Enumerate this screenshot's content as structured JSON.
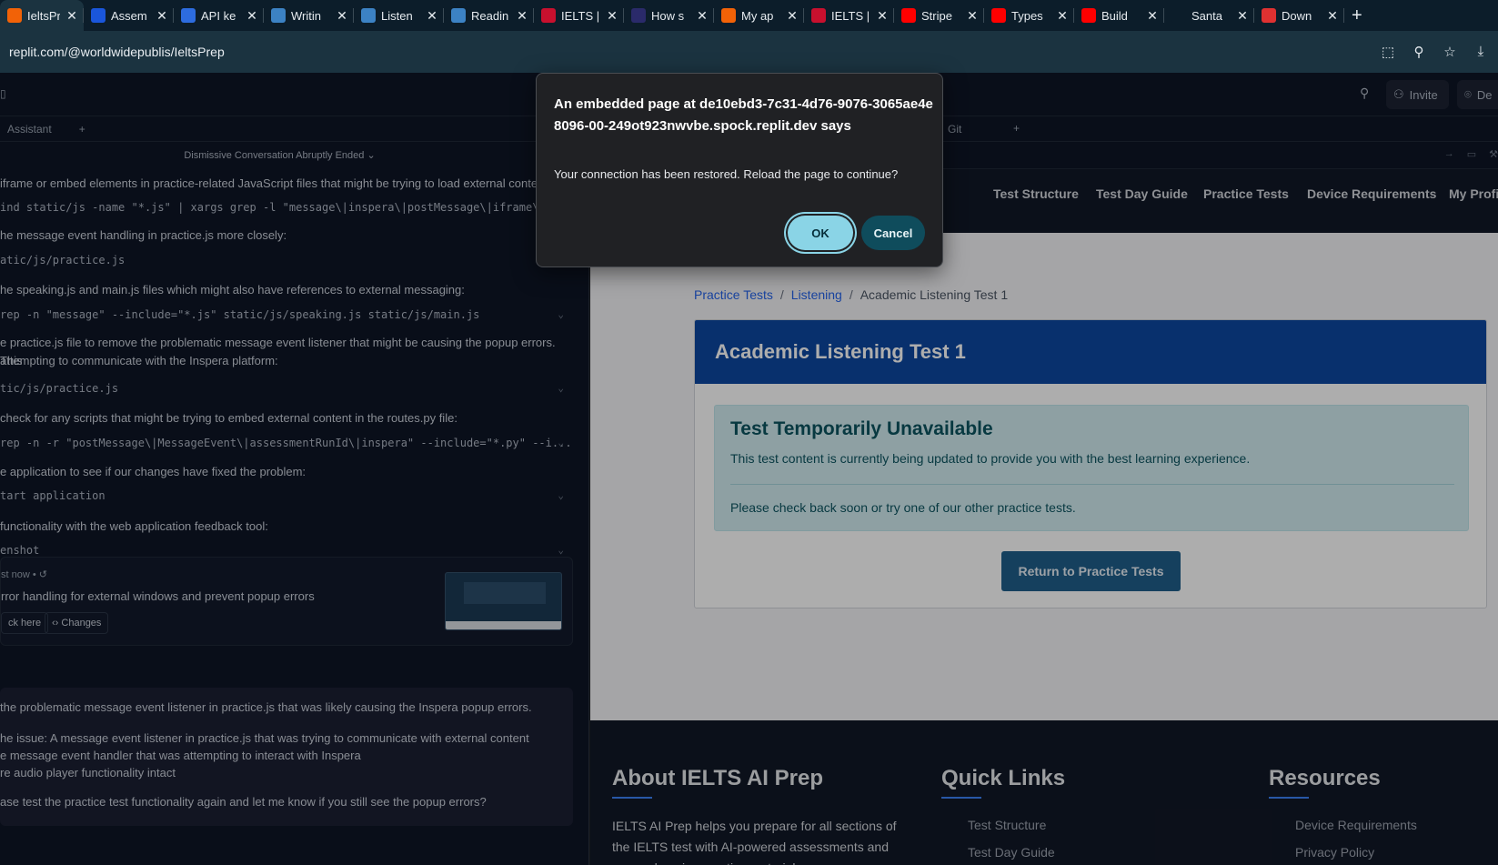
{
  "browser": {
    "tabs": [
      {
        "title": "IeltsPr",
        "icon": "replit-icon",
        "color": "#f26207",
        "active": true
      },
      {
        "title": "Assem",
        "icon": "assembly-icon",
        "color": "#1a56db"
      },
      {
        "title": "API ke",
        "icon": "openai-icon",
        "color": "#2d6cdf"
      },
      {
        "title": "Writin",
        "icon": "chart-icon",
        "color": "#3c82c4"
      },
      {
        "title": "Listen",
        "icon": "dots-icon",
        "color": "#3c82c4"
      },
      {
        "title": "Readin",
        "icon": "chart-icon",
        "color": "#3c82c4"
      },
      {
        "title": "IELTS |",
        "icon": "ielts-icon",
        "color": "#c8102e"
      },
      {
        "title": "How s",
        "icon": "circle-icon",
        "color": "#2a2a6a"
      },
      {
        "title": "My ap",
        "icon": "app-icon",
        "color": "#f26207"
      },
      {
        "title": "IELTS |",
        "icon": "ielts-icon",
        "color": "#c8102e"
      },
      {
        "title": "Stripe",
        "icon": "youtube-icon",
        "color": "#ff0000"
      },
      {
        "title": "Types",
        "icon": "youtube-icon",
        "color": "#ff0000"
      },
      {
        "title": "Build",
        "icon": "youtube-icon",
        "color": "#ff0000"
      },
      {
        "title": "Santa",
        "icon": "sparkle-icon",
        "color": "#0c1d2a"
      },
      {
        "title": "Down",
        "icon": "download-site-icon",
        "color": "#e03131"
      }
    ],
    "url": "replit.com/@worldwidepublis/IeltsPrep"
  },
  "replit": {
    "invite_label": "Invite",
    "deploy_label": "De",
    "assistant_tab": "Assistant",
    "conversation_title": "Dismissive Conversation Abruptly Ended",
    "git_tab": "Git",
    "steps": [
      {
        "text": "iframe or embed elements in practice-related JavaScript files that might be trying to load external conten",
        "cmd": "ind static/js -name \"*.js\" | xargs grep -l \"message\\|inspera\\|postMessage\\|iframe\\|e"
      },
      {
        "text": "he message event handling in practice.js more closely:",
        "cmd": "atic/js/practice.js"
      },
      {
        "text": "he speaking.js and main.js files which might also have references to external messaging:",
        "cmd": "rep -n \"message\" --include=\"*.js\" static/js/speaking.js static/js/main.js"
      },
      {
        "text": "e practice.js file to remove the problematic message event listener that might be causing the popup errors. This",
        "text2": "attempting to communicate with the Inspera platform:",
        "cmd": "tic/js/practice.js"
      },
      {
        "text": "check for any scripts that might be trying to embed external content in the routes.py file:",
        "cmd": "rep -n -r \"postMessage\\|MessageEvent\\|assessmentRunId\\|inspera\" --include=\"*.py\" --i..."
      },
      {
        "text": "e application to see if our changes have fixed the problem:",
        "cmd": "tart application"
      },
      {
        "text": "functionality with the web application feedback tool:",
        "cmd": "enshot"
      }
    ],
    "checkpoint": {
      "time": "st now",
      "message": "rror handling for external windows and prevent popup errors",
      "rollback_label": "ck here",
      "changes_label": "Changes"
    },
    "summary": [
      "the problematic message event listener in practice.js that was likely causing the Inspera popup errors.",
      "he issue: A message event listener in practice.js that was trying to communicate with external content",
      "e message event handler that was attempting to interact with Inspera",
      "re audio player functionality intact",
      "ase test the practice test functionality again and let me know if you still see the popup errors?"
    ]
  },
  "site": {
    "nav": [
      "Test Structure",
      "Test Day Guide",
      "Practice Tests",
      "Device Requirements",
      "My Profi"
    ],
    "breadcrumb": {
      "level1": "Practice Tests",
      "level2": "Listening",
      "current": "Academic Listening Test 1",
      "sep": "/"
    },
    "test_title": "Academic Listening Test 1",
    "alert_heading": "Test Temporarily Unavailable",
    "alert_text1": "This test content is currently being updated to provide you with the best learning experience.",
    "alert_text2": "Please check back soon or try one of our other practice tests.",
    "return_button": "Return to Practice Tests",
    "footer": {
      "about_title": "About IELTS AI Prep",
      "about_text": "IELTS AI Prep helps you prepare for all sections of the IELTS test with AI-powered assessments and comprehensive practice materials.",
      "quick_links_title": "Quick Links",
      "quick_links": [
        "Test Structure",
        "Test Day Guide"
      ],
      "resources_title": "Resources",
      "resources": [
        "Device Requirements",
        "Privacy Policy"
      ]
    }
  },
  "dialog": {
    "title": "An embedded page at de10ebd3-7c31-4d76-9076-3065ae4e8096-00-249ot923nwvbe.spock.replit.dev says",
    "message": "Your connection has been restored. Reload the page to continue?",
    "ok_label": "OK",
    "cancel_label": "Cancel"
  },
  "colors": {
    "site_header": "#0d47a1",
    "alert_bg": "#d1ecf1",
    "ok_button": "#8ad4e6",
    "cancel_button": "#0f4c5c"
  }
}
